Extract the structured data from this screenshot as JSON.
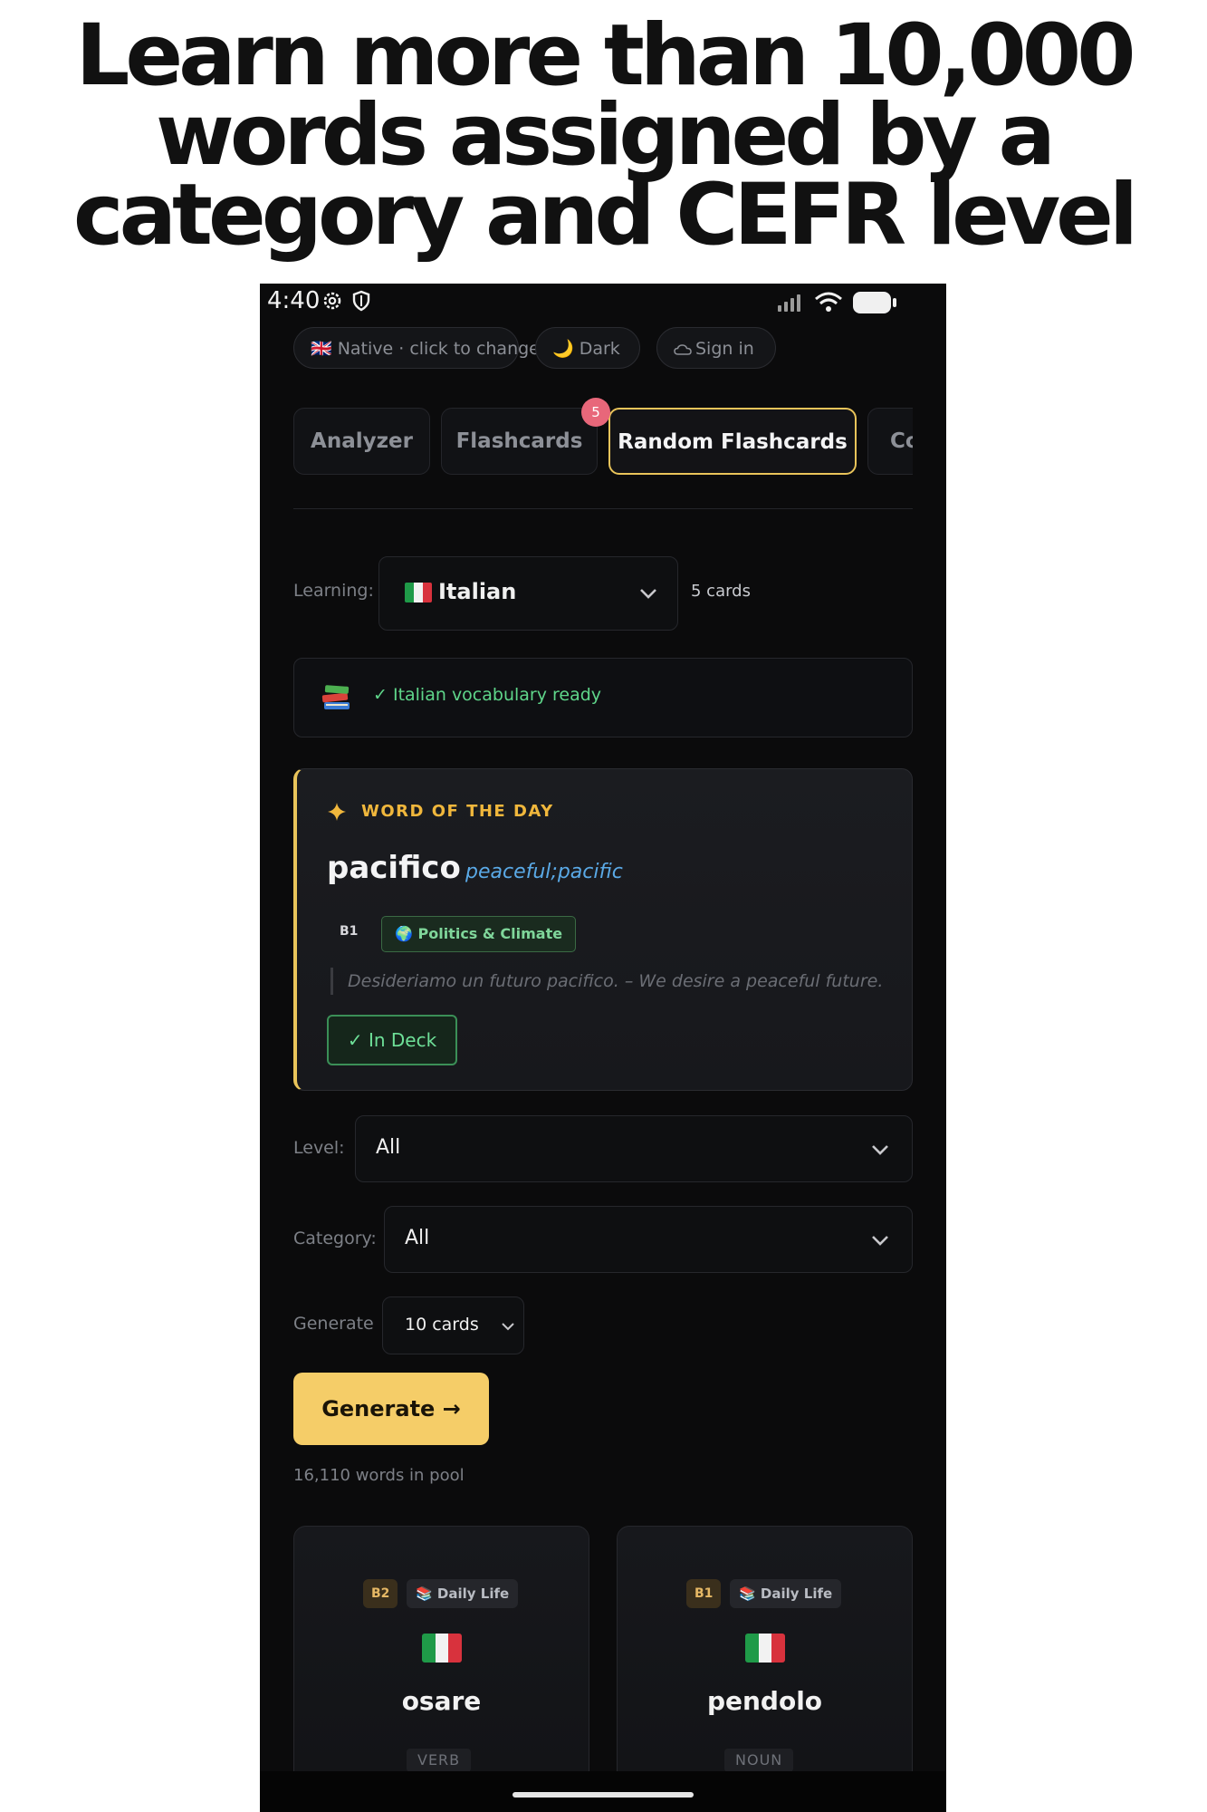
{
  "headline": {
    "line1": "Learn more than 10,000",
    "line2": "words assigned by a",
    "line3": "category and CEFR level"
  },
  "status_bar": {
    "time": "4:40"
  },
  "top_pills": {
    "native": "🇬🇧 Native · click to change",
    "dark": "🌙 Dark",
    "sign_in": "Sign in"
  },
  "tabs": [
    {
      "label": "Analyzer"
    },
    {
      "label": "Flashcards"
    },
    {
      "label": "Random Flashcards"
    },
    {
      "label": "Co"
    }
  ],
  "flashcards_badge": "5",
  "learning": {
    "label": "Learning:",
    "language": "Italian",
    "cards_count": "5 cards"
  },
  "vocab_status": {
    "icon": "books-icon",
    "text": "✓ Italian vocabulary ready"
  },
  "word_of_day": {
    "heading": "WORD OF THE DAY",
    "word": "pacifico",
    "translation": "peaceful;pacific",
    "level": "B1",
    "category": "🌍 Politics & Climate",
    "example": "Desideriamo un futuro pacifico. – We desire a peaceful future.",
    "deck_button": "✓ In Deck"
  },
  "filters": {
    "level_label": "Level:",
    "level_value": "All",
    "category_label": "Category:",
    "category_value": "All",
    "generate_label": "Generate",
    "generate_value": "10 cards"
  },
  "generate_button": "Generate →",
  "pool_text": "16,110 words in pool",
  "cards": [
    {
      "level": "B2",
      "category": "📚 Daily Life",
      "word": "osare",
      "pos": "VERB"
    },
    {
      "level": "B1",
      "category": "📚 Daily Life",
      "word": "pendolo",
      "pos": "NOUN"
    }
  ],
  "colors": {
    "accent": "#f5cd68",
    "background": "#0b0b0c",
    "success": "#5fd68a",
    "link": "#5aa9e6",
    "badge": "#e8677a"
  }
}
